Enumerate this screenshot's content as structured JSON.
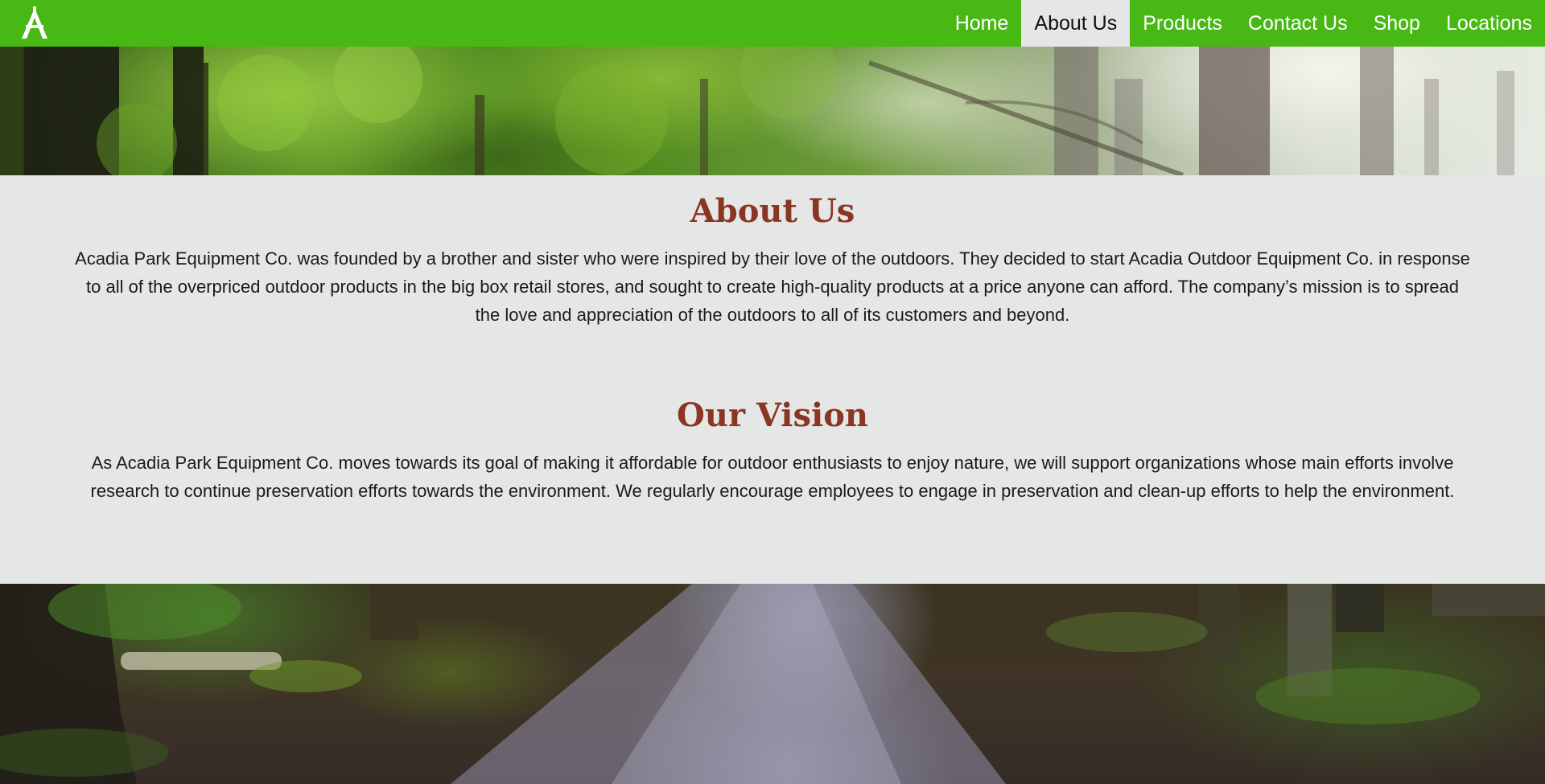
{
  "nav": {
    "items": [
      {
        "label": "Home",
        "active": false
      },
      {
        "label": "About Us",
        "active": true
      },
      {
        "label": "Products",
        "active": false
      },
      {
        "label": "Contact Us",
        "active": false
      },
      {
        "label": "Shop",
        "active": false
      },
      {
        "label": "Locations",
        "active": false
      }
    ]
  },
  "about": {
    "title": "About Us",
    "text": "Acadia Park Equipment Co. was founded by a brother and sister who were inspired by their love of the outdoors. They decided to start Acadia Outdoor Equipment Co. in response to all of the overpriced outdoor products in the big box retail stores, and sought to create high-quality products at a price anyone can afford. The company’s mission is to spread the love and appreciation of the outdoors to all of its customers and beyond."
  },
  "vision": {
    "title": "Our Vision",
    "text": "As Acadia Park Equipment Co. moves towards its goal of making it affordable for outdoor enthusiasts to enjoy nature, we will support organizations whose main efforts involve research to continue preservation efforts towards the environment. We regularly encourage employees to engage in preservation and clean-up efforts to help the environment."
  },
  "colors": {
    "nav_green": "#48b814",
    "heading_red": "#8b3524",
    "panel_grey": "#e5e7e6"
  },
  "icons": {
    "logo": "acadia-a-logo-icon"
  }
}
